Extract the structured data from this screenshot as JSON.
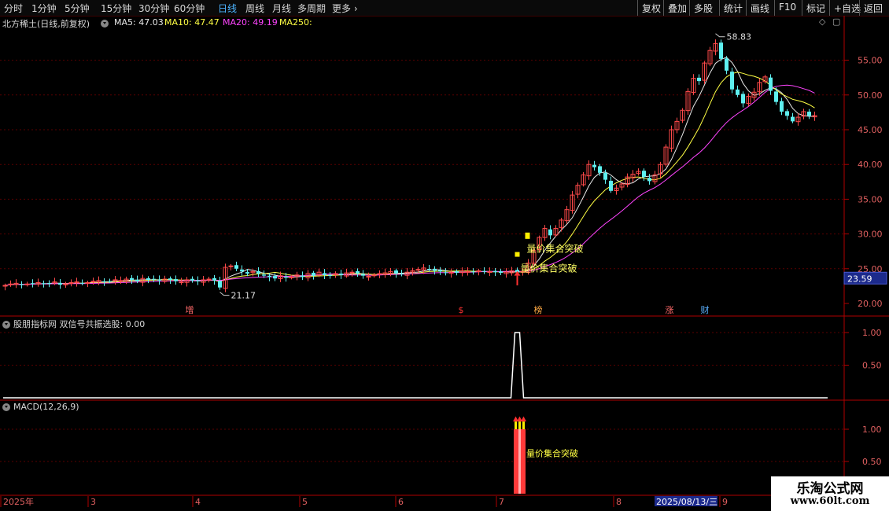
{
  "toolbar": {
    "left_tabs": [
      "分时",
      "1分钟",
      "5分钟",
      "15分钟",
      "30分钟",
      "60分钟",
      "日线",
      "周线",
      "月线",
      "多周期",
      "更多"
    ],
    "active_tab": "日线",
    "right_buttons": [
      "复权",
      "叠加",
      "多股",
      "统计",
      "画线",
      "F10",
      "标记",
      "+自选",
      "返回"
    ]
  },
  "stock": {
    "title": "北方稀土(日线,前复权)",
    "ma5_label": "MA5: 47.03",
    "ma10_label": "MA10: 47.47",
    "ma20_label": "MA20: 49.19",
    "ma250_label": "MA250:",
    "high_label": "58.83",
    "low_label": "21.17",
    "current_price": "23.59",
    "signal_label": "量价集合突破"
  },
  "colors": {
    "up": "#ff4a4a",
    "down": "#5ef0f0",
    "ma5": "#e8e8e8",
    "ma10": "#ffff44",
    "ma20": "#ff44ff",
    "grid": "#5a0000",
    "axis": "#b00000"
  },
  "price_axis": [
    "55.00",
    "50.00",
    "45.00",
    "40.00",
    "35.00",
    "30.00",
    "25.00",
    "20.00"
  ],
  "event_markers": [
    {
      "text": "增",
      "color": "#ff6a6a"
    },
    {
      "text": "$",
      "color": "#ff3333"
    },
    {
      "text": "榜",
      "color": "#ffaa44"
    },
    {
      "text": "涨",
      "color": "#ff6a6a"
    },
    {
      "text": "财",
      "color": "#5ab0ff"
    }
  ],
  "indicator1": {
    "title": "股朋指标网 双信号共振选股: 0.00",
    "axis": [
      "1.00",
      "0.50"
    ]
  },
  "macd": {
    "title": "MACD(12,26,9)",
    "axis": [
      "1.00",
      "0.50"
    ],
    "signal_text": "量价集合突破"
  },
  "date_axis": {
    "labels": [
      "2025年",
      "3",
      "4",
      "5",
      "6",
      "7",
      "8",
      "9"
    ],
    "highlight": "2025/08/13/三"
  },
  "watermark": {
    "line1": "乐淘公式网",
    "line2": "www.60lt.com"
  },
  "chart_data": {
    "type": "candlestick",
    "title": "北方稀土(日线,前复权)",
    "ylim": [
      19,
      60
    ],
    "high": 58.83,
    "low": 21.17,
    "closes": [
      22.6,
      22.8,
      22.9,
      22.7,
      22.8,
      22.9,
      23.0,
      22.8,
      22.9,
      23.1,
      22.7,
      22.8,
      23.0,
      23.1,
      22.9,
      23.0,
      23.2,
      23.3,
      23.1,
      23.2,
      23.4,
      23.3,
      23.5,
      23.4,
      23.2,
      23.6,
      23.4,
      23.5,
      23.3,
      23.5,
      23.4,
      23.2,
      23.1,
      23.4,
      23.3,
      23.2,
      23.4,
      23.5,
      23.3,
      22.3,
      25.2,
      25.4,
      25.0,
      24.6,
      24.3,
      24.6,
      24.3,
      24.0,
      23.8,
      23.6,
      24.0,
      23.7,
      23.8,
      24.1,
      23.8,
      24.3,
      24.0,
      24.5,
      24.1,
      24.0,
      24.3,
      24.1,
      24.4,
      24.5,
      24.3,
      24.0,
      23.9,
      24.1,
      24.3,
      24.4,
      24.6,
      24.3,
      24.2,
      24.5,
      24.7,
      24.9,
      25.1,
      24.9,
      24.7,
      24.6,
      24.4,
      24.5,
      24.4,
      24.7,
      24.6,
      24.5,
      24.7,
      24.6,
      24.6,
      24.5,
      24.4,
      24.5,
      24.7,
      24.5,
      24.6,
      25.8,
      27.6,
      29.5,
      30.8,
      29.8,
      30.8,
      32.0,
      33.5,
      35.6,
      37.0,
      38.5,
      40.0,
      39.6,
      38.8,
      37.8,
      36.2,
      36.6,
      37.2,
      38.2,
      38.6,
      39.0,
      38.2,
      37.6,
      38.5,
      40.0,
      42.5,
      45.0,
      46.2,
      47.8,
      50.5,
      52.4,
      52.0,
      54.6,
      56.4,
      57.4,
      55.2,
      53.5,
      50.8,
      50.0,
      48.8,
      49.8,
      50.4,
      51.8,
      52.6,
      50.6,
      49.0,
      47.6,
      47.0,
      46.2,
      46.8,
      47.6,
      47.0,
      47.03
    ],
    "signals": [
      {
        "index": 93,
        "label": "量价集合突破"
      },
      {
        "index": 94,
        "label": "量价集合突破"
      }
    ]
  }
}
